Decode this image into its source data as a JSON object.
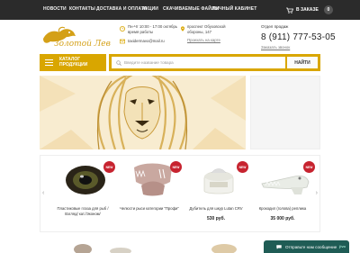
{
  "topnav": {
    "items": [
      "НОВОСТИ",
      "КОНТАКТЫ",
      "ДОСТАВКА И ОПЛАТА",
      "АКЦИИ",
      "СКАЧИВАЕМЫЕ ФАЙЛЫ",
      "ЛИЧНЫЙ КАБИНЕТ"
    ],
    "cart_label": "В ЗАКАЗЕ",
    "cart_count": "0"
  },
  "logo": {
    "text": "Золотой Лев"
  },
  "header": {
    "hours": "Пн-Чт 10:00 - 17:00 октябрь время работы",
    "email": "taxidermavo@mail.ru",
    "address": "проспект Обуховской обороны, 147",
    "map_link": "Проехать на карте",
    "dept_label": "Отдел продаж",
    "phone": "8 (911) 777-53-05",
    "callback_link": "Заказать звонок"
  },
  "catalog": {
    "label": "КАТАЛОГ ПРОДУКЦИИ"
  },
  "search": {
    "placeholder": "Введите название товара",
    "button_label": "НАЙТИ"
  },
  "products": [
    {
      "name": "Пластиковые глаза для рыб / Взгляд/ кат./Эконом/",
      "price": "",
      "badge": "NEW"
    },
    {
      "name": "Челюсти рыси категории \"Профи\"",
      "price": "",
      "badge": "NEW"
    },
    {
      "name": "Дубитель для шкур Lutan CRV",
      "price": "530 руб.",
      "badge": "NEW"
    },
    {
      "name": "Крокодил (голова) реплика",
      "price": "35 000 руб.",
      "badge": "NEW"
    }
  ],
  "chat": {
    "text": "Отправьте нам сообщение",
    "brand": "jivo"
  },
  "colors": {
    "accent": "#d9a600",
    "nav_bg": "#2b2b2b",
    "badge": "#c7232f",
    "chat_bg": "#1f5c55"
  }
}
